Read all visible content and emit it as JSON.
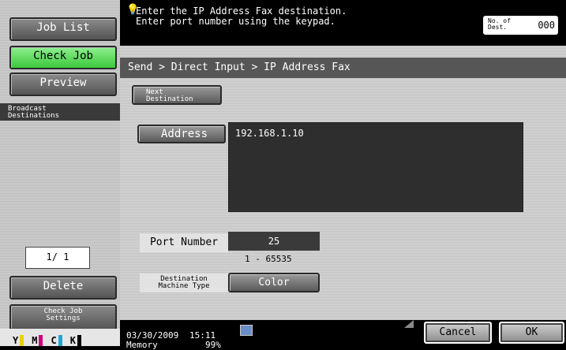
{
  "left_panel": {
    "job_list": "Job List",
    "check_job": "Check Job",
    "preview": "Preview",
    "broadcast_line1": "Broadcast",
    "broadcast_line2": "Destinations",
    "pager": "1/  1",
    "delete": "Delete",
    "check_job_settings_line1": "Check Job",
    "check_job_settings_line2": "Settings",
    "toner": [
      {
        "label": "Y",
        "color": "#e8d200"
      },
      {
        "label": "M",
        "color": "#d0007c"
      },
      {
        "label": "C",
        "color": "#1da7d8"
      },
      {
        "label": "K",
        "color": "#000000"
      }
    ]
  },
  "message": {
    "line1": "Enter the IP Address Fax destination.",
    "line2": "Enter port number using the keypad.",
    "dest_label_line1": "No. of",
    "dest_label_line2": "Dest.",
    "dest_count": "000"
  },
  "main": {
    "breadcrumb": "Send > Direct Input > IP Address Fax",
    "next_destination_line1": "Next",
    "next_destination_line2": "Destination",
    "address_label": "Address",
    "address_value": "192.168.1.10",
    "port_label": "Port Number",
    "port_value": "25",
    "port_range": "1  -  65535",
    "dest_machine_line1": "Destination",
    "dest_machine_line2": "Machine Type",
    "color_label": "Color"
  },
  "status": {
    "date": "03/30/2009",
    "time": "15:11",
    "memory_label": "Memory",
    "memory_value": "99%",
    "cancel": "Cancel",
    "ok": "OK"
  }
}
